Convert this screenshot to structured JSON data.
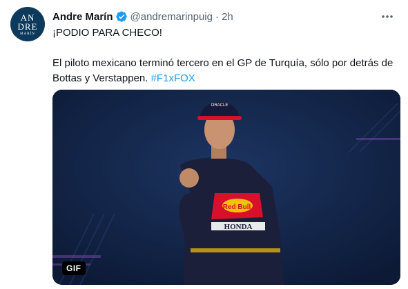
{
  "avatar": {
    "line1": "AN",
    "line2": "DRE",
    "line3": "MARÍN"
  },
  "user": {
    "display_name": "Andre Marín",
    "handle": "@andremarinpuig",
    "separator": "·",
    "time": "2h"
  },
  "tweet": {
    "line1": "¡PODIO PARA CHECO!",
    "body": "El piloto mexicano terminó tercero en el GP de Turquía, sólo por detrás de Bottas y Verstappen.",
    "hashtag": "#F1xFOX"
  },
  "media": {
    "badge": "GIF",
    "suit_text": {
      "brand": "Red Bull",
      "sponsor": "HONDA",
      "helmet_brand": "ORACLE"
    }
  },
  "colors": {
    "verified": "#1d9bf0",
    "hashtag": "#1d9bf0",
    "media_bg": "#14274a",
    "suit": "#1c1f3a",
    "suit_accent": "#d8102c",
    "suit_yellow": "#f5c400"
  },
  "icons": {
    "verified": "verified-badge-icon",
    "more": "more-dots-icon"
  }
}
